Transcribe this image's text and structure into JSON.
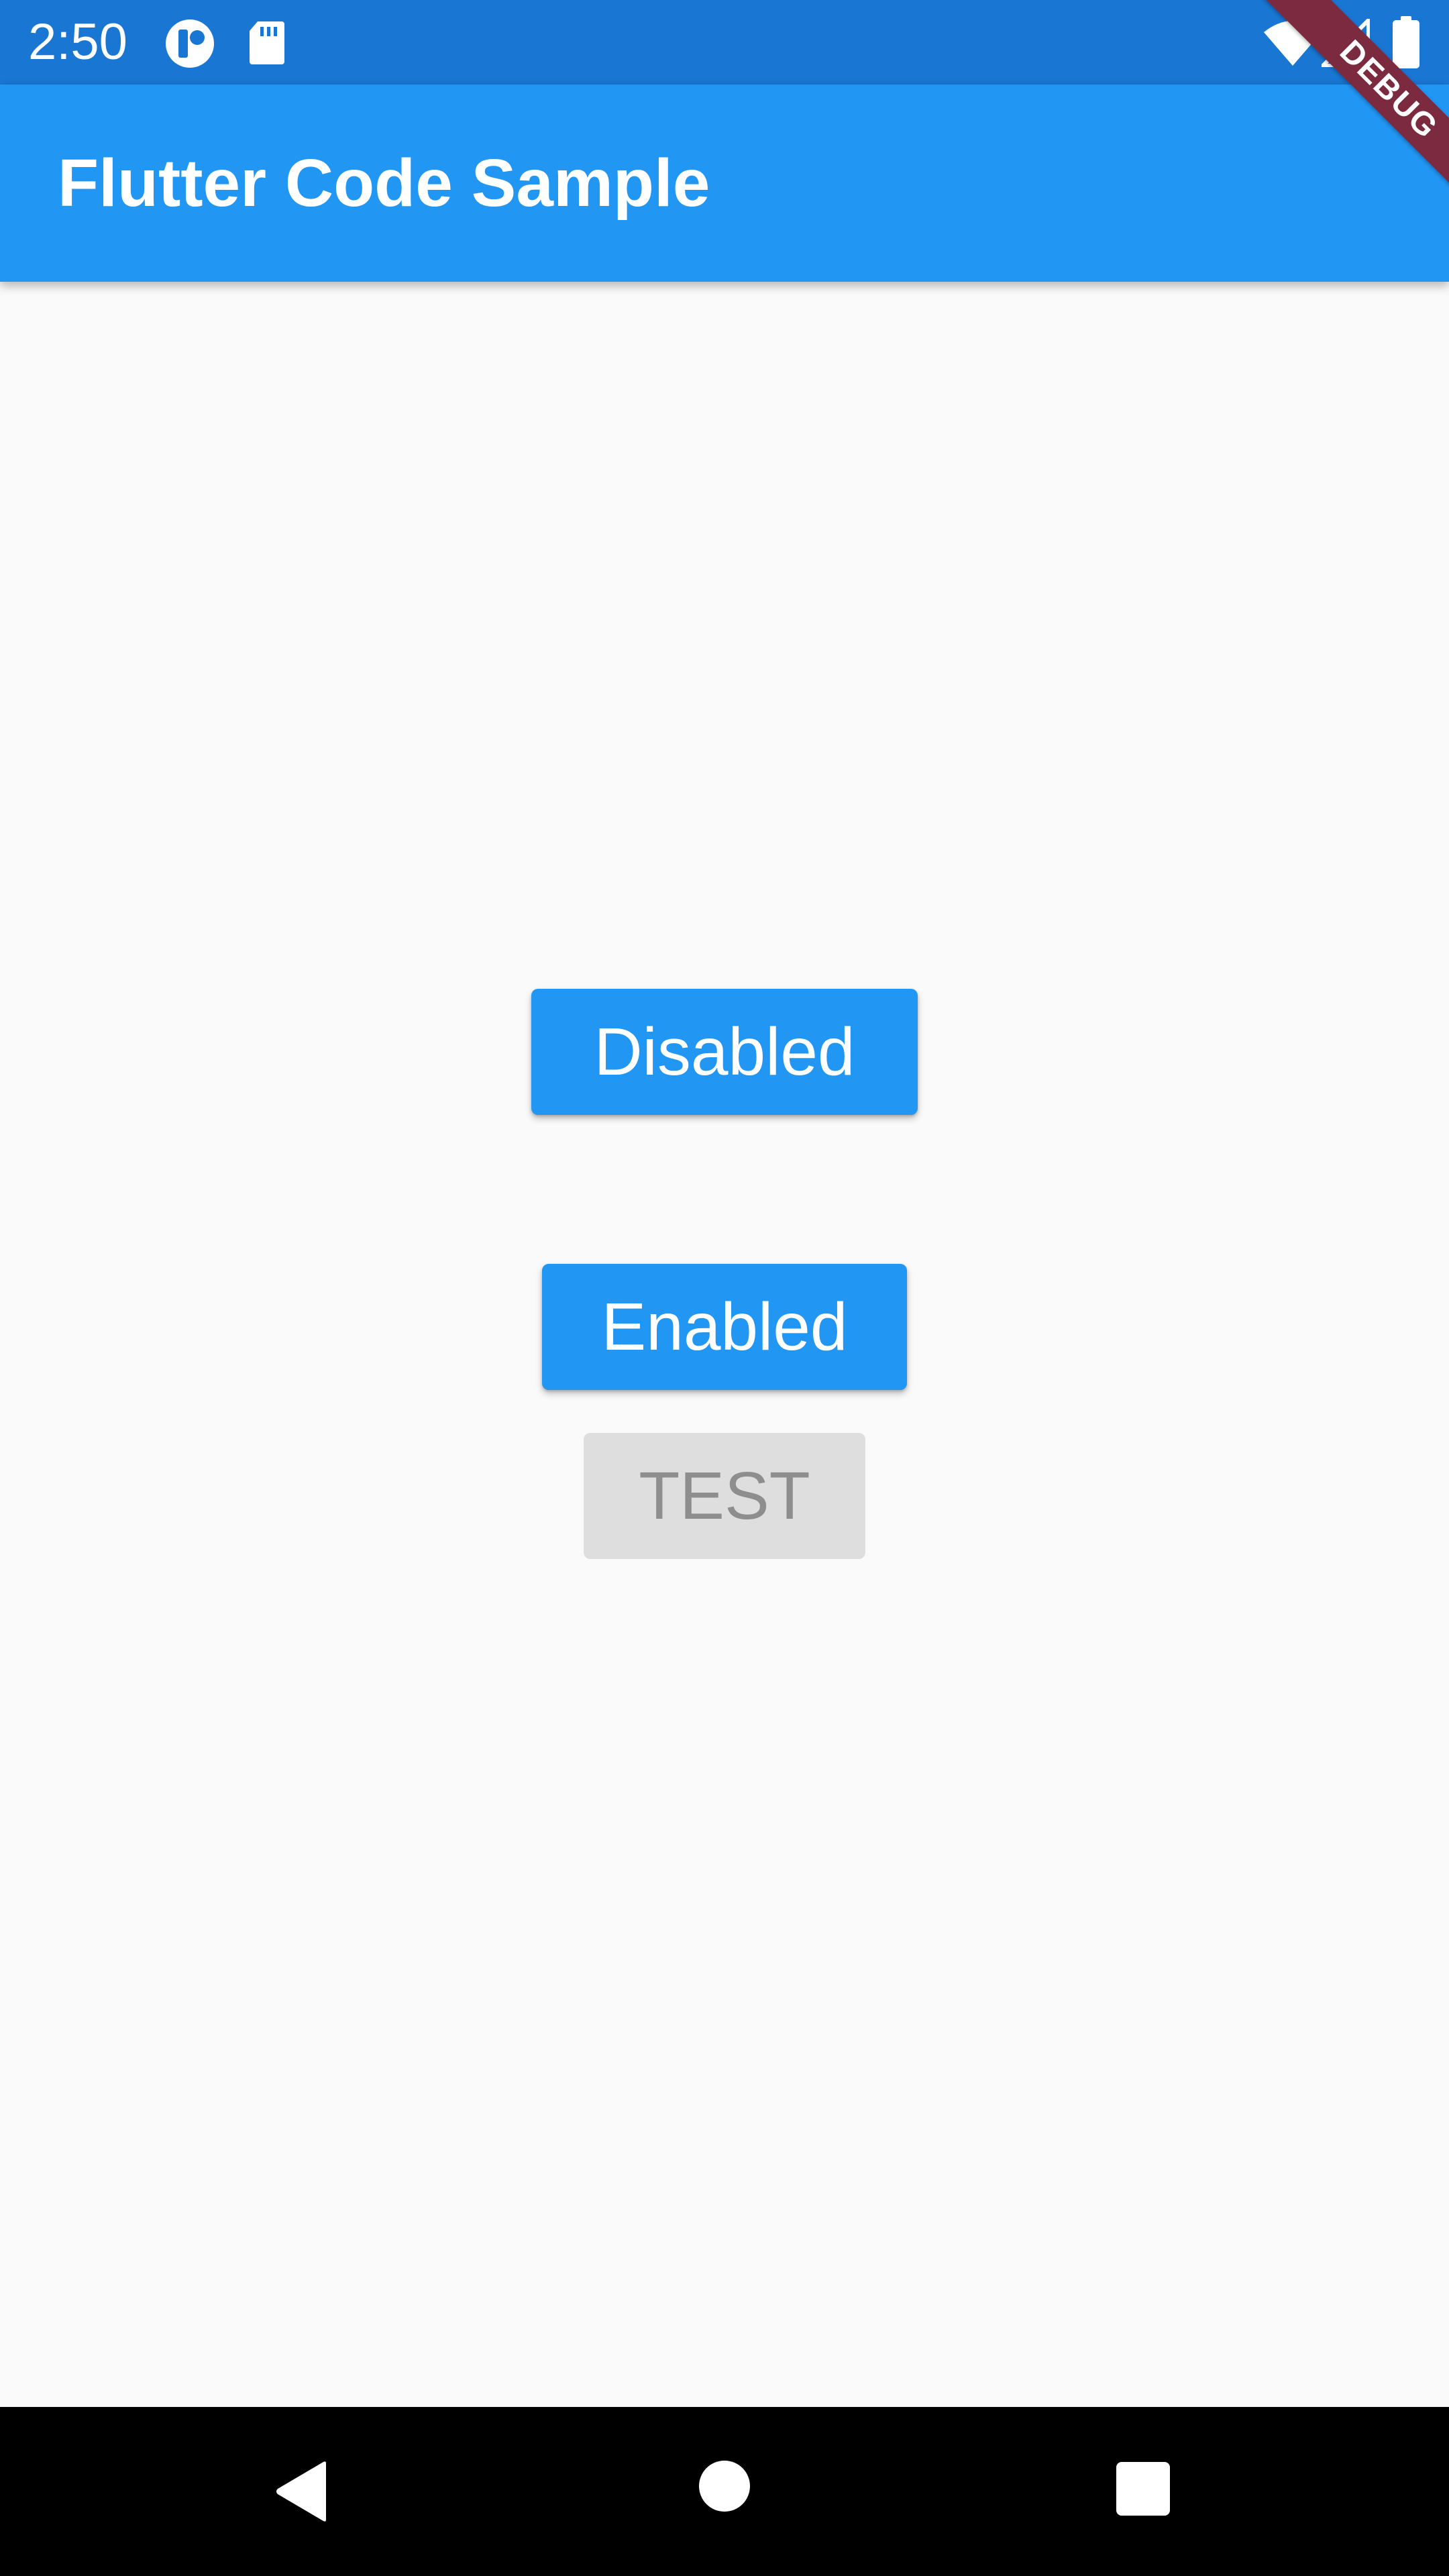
{
  "status_bar": {
    "time": "2:50",
    "icons": [
      "notification-app-icon",
      "sd-card-icon",
      "wifi-icon",
      "cell-signal-icon",
      "battery-icon"
    ],
    "background": "#1976d2"
  },
  "app_bar": {
    "title": "Flutter Code Sample",
    "background": "#2196f3"
  },
  "debug_banner": {
    "label": "DEBUG",
    "color": "#7b2a3f"
  },
  "main": {
    "buttons": [
      {
        "label": "Disabled"
      },
      {
        "label": "Enabled"
      },
      {
        "label": "TEST"
      }
    ]
  },
  "nav_bar": {
    "icons": [
      "back-icon",
      "home-icon",
      "recents-icon"
    ]
  },
  "colors": {
    "primary": "#2196f3",
    "background": "#fafafa",
    "disabled_bg": "#dedede",
    "disabled_text": "#8e8e8e"
  }
}
